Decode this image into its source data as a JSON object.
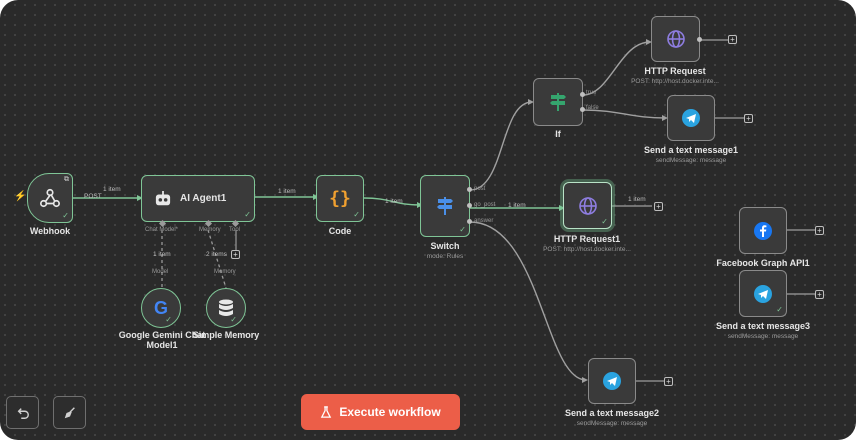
{
  "nodes": {
    "webhook": {
      "title": "Webhook"
    },
    "ai_agent": {
      "title": "AI Agent1",
      "port_chat_model": "Chat Model*",
      "port_memory": "Memory",
      "port_tool": "Tool"
    },
    "code": {
      "title": "Code"
    },
    "switch": {
      "title": "Switch",
      "subtitle": "mode: Rules",
      "out_1": "post",
      "out_2": "go_post",
      "out_3": "answer"
    },
    "if": {
      "title": "If",
      "out_true": "true",
      "out_false": "false"
    },
    "http_request": {
      "title": "HTTP Request",
      "subtitle": "POST: http://host.docker.inte..."
    },
    "send_text_1": {
      "title": "Send a text message1",
      "subtitle": "sendMessage: message"
    },
    "http_request_1": {
      "title": "HTTP Request1",
      "subtitle": "POST: http://host.docker.inte..."
    },
    "gemini": {
      "title": "Google Gemini Chat Model1",
      "title_line1": "Google Gemini Chat",
      "title_line2": "Model1",
      "port": "Model"
    },
    "memory": {
      "title": "Simple Memory",
      "port": "Memory"
    },
    "facebook": {
      "title": "Facebook Graph API1"
    },
    "send_text_3": {
      "title": "Send a text message3",
      "subtitle": "sendMessage: message"
    },
    "send_text_2": {
      "title": "Send a text message2",
      "subtitle": "sendMessage: message"
    }
  },
  "edges": {
    "webhook_method": "POST",
    "webhook_to_agent": "1 item",
    "agent_to_code": "1 item",
    "code_to_switch": "1 item",
    "switch_to_http1": "1 item",
    "http1_out": "1 item",
    "gemini_to_agent": "1 item",
    "memory_to_agent": "2 items"
  },
  "toolbar": {
    "execute_label": "Execute workflow",
    "undo_icon": "undo-icon",
    "clean_icon": "broom-icon"
  },
  "colors": {
    "canvas": "#2a2a2a",
    "success_border": "#7fc596",
    "execute_button": "#ec5e48",
    "switch_icon": "#4a8fe8",
    "if_icon": "#35a56e",
    "http_icon": "#8e7de0",
    "telegram": "#2aa3e0",
    "facebook": "#1877f2",
    "code_icon": "#f0a030",
    "trigger_bolt": "#e85454"
  }
}
